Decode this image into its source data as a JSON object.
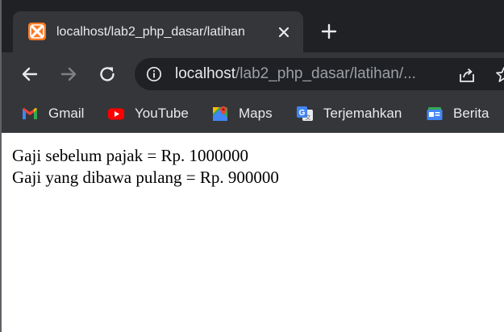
{
  "browser": {
    "tab": {
      "title": "localhost/lab2_php_dasar/latihan",
      "favicon": "xampp-icon"
    },
    "address_bar": {
      "host": "localhost",
      "path": "/lab2_php_dasar/latihan/..."
    },
    "bookmarks": [
      {
        "label": "Gmail",
        "icon": "gmail-icon"
      },
      {
        "label": "YouTube",
        "icon": "youtube-icon"
      },
      {
        "label": "Maps",
        "icon": "maps-icon"
      },
      {
        "label": "Terjemahkan",
        "icon": "translate-icon"
      },
      {
        "label": "Berita",
        "icon": "news-icon"
      }
    ]
  },
  "page": {
    "lines": [
      "Gaji sebelum pajak = Rp. 1000000",
      "Gaji yang dibawa pulang = Rp. 900000"
    ]
  },
  "colors": {
    "tabstrip_bg": "#202124",
    "toolbar_bg": "#35363a",
    "xampp_orange": "#fb7a24",
    "text_light": "#e8eaed",
    "text_dim": "#9aa0a6"
  }
}
